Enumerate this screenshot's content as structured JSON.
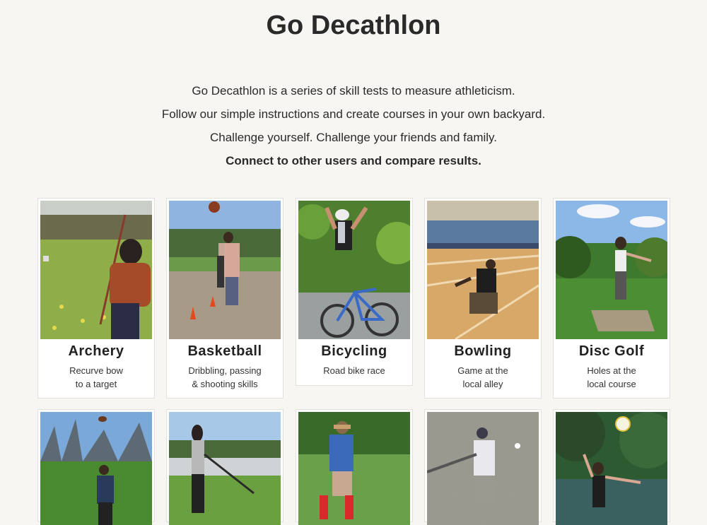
{
  "header": {
    "title": "Go Decathlon"
  },
  "intro": {
    "line1": "Go Decathlon is a series of skill tests to measure athleticism.",
    "line2": "Follow our simple instructions and create courses in your own backyard.",
    "line3": "Challenge yourself. Challenge your friends and family.",
    "line4": "Connect to other users and compare results."
  },
  "events": [
    {
      "title": "Archery",
      "desc1": "Recurve bow",
      "desc2": "to a target"
    },
    {
      "title": "Basketball",
      "desc1": "Dribbling, passing",
      "desc2": "& shooting skills"
    },
    {
      "title": "Bicycling",
      "desc1": "Road bike race",
      "desc2": ""
    },
    {
      "title": "Bowling",
      "desc1": "Game at the",
      "desc2": "local alley"
    },
    {
      "title": "Disc Golf",
      "desc1": "Holes at the",
      "desc2": "local course"
    }
  ],
  "row2_photos": [
    "football-throw-photo",
    "field-hockey-photo",
    "soccer-kick-photo",
    "softball-batting-photo",
    "volleyball-photo"
  ]
}
